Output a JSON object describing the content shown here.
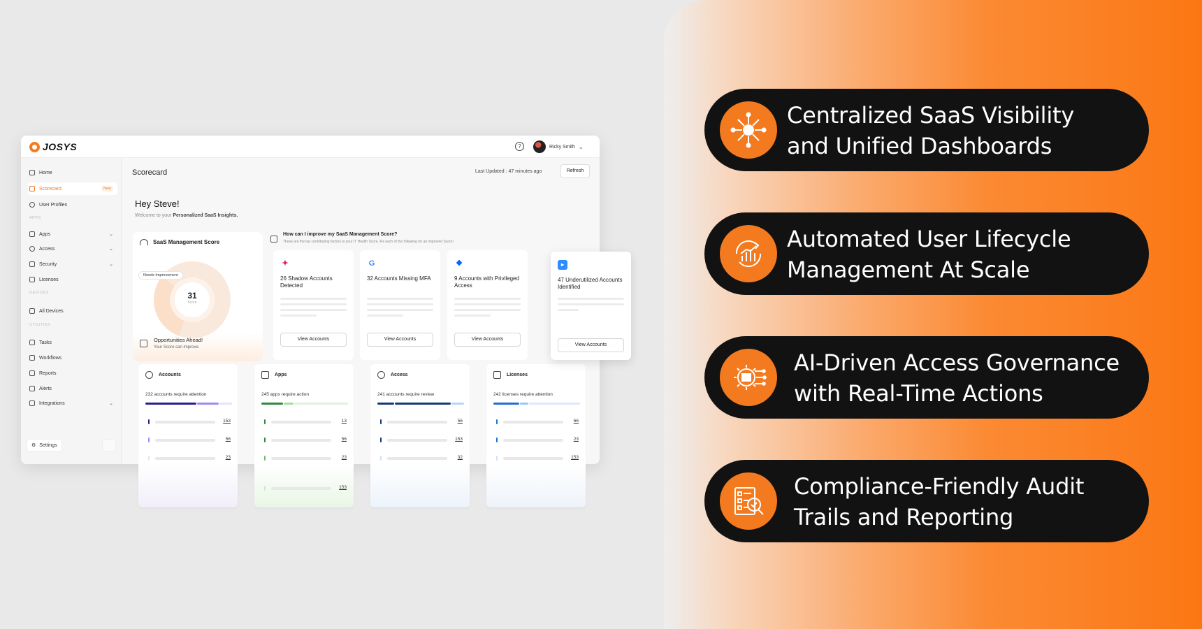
{
  "brand": {
    "logo_text": "JOSYS"
  },
  "topbar": {
    "help_icon": "question-circle-icon",
    "user_name": "Ricky Smith"
  },
  "sidebar": {
    "items": [
      {
        "label": "Home",
        "icon": "home-icon"
      },
      {
        "label": "Scorecard",
        "icon": "gauge-icon",
        "badge": "New",
        "active": true
      },
      {
        "label": "User Profiles",
        "icon": "user-icon"
      },
      {
        "label": "Apps",
        "icon": "grid-icon"
      },
      {
        "label": "Access",
        "icon": "key-icon"
      },
      {
        "label": "Security",
        "icon": "shield-icon"
      },
      {
        "label": "Licenses",
        "icon": "license-icon"
      },
      {
        "label": "All Devices",
        "icon": "monitor-icon"
      },
      {
        "label": "Tasks",
        "icon": "list-icon"
      },
      {
        "label": "Workflows",
        "icon": "workflow-icon"
      },
      {
        "label": "Reports",
        "icon": "report-icon"
      },
      {
        "label": "Alerts",
        "icon": "alert-icon"
      },
      {
        "label": "Integrations",
        "icon": "integration-icon"
      }
    ],
    "sections": [
      "APPS",
      "DEVICES",
      "UTILITIES"
    ],
    "settings_label": "Settings"
  },
  "main": {
    "title": "Scorecard",
    "last_updated": "Last Updated : 47 minutes ago",
    "refresh_label": "Refresh",
    "greeting": "Hey Steve!",
    "welcome_prefix": "Welcome to your ",
    "welcome_bold": "Personalized SaaS Insights.",
    "score": {
      "title": "SaaS Management Score",
      "badge": "Needs Improvement",
      "value": "31",
      "value_label": "Score",
      "opps_title": "Opportunities Ahead!",
      "opps_sub": "Your Score can improve."
    },
    "improve": {
      "question": "How can I improve my SaaS Management Score?",
      "subtitle": "These are the top contributing factors to your IT Health Score. Fix each of the following for an improved Score!"
    },
    "factors": [
      {
        "title": "26 Shadow Accounts Detected",
        "logo": "slack-logo-icon",
        "color": "#e01e5a",
        "button": "View Accounts"
      },
      {
        "title": "32 Accounts Missing MFA",
        "logo": "google-logo-icon",
        "color": "#4285f4",
        "button": "View Accounts"
      },
      {
        "title": "9 Accounts with Privileged Access",
        "logo": "dropbox-logo-icon",
        "color": "#0061fe",
        "button": "View Accounts"
      },
      {
        "title": "47 Underutilized Accounts Identified",
        "logo": "zoom-logo-icon",
        "color": "#2d8cff",
        "button": "View Accounts"
      }
    ],
    "stats": [
      {
        "title": "Accounts",
        "subtitle": "232 accounts require attention",
        "color": "#2a1f8f",
        "light": "#9b8ef0",
        "rows": [
          "153",
          "56",
          "23"
        ]
      },
      {
        "title": "Apps",
        "subtitle": "245 apps require action",
        "color": "#2e8b3a",
        "light": "#a8dca0",
        "rows": [
          "13",
          "56",
          "23",
          "153"
        ]
      },
      {
        "title": "Access",
        "subtitle": "241 accounts require review",
        "color": "#123a7a",
        "light": "#b9d4f2",
        "rows": [
          "56",
          "153",
          "32"
        ]
      },
      {
        "title": "Licenses",
        "subtitle": "242 licenses require attention",
        "color": "#1f6fd1",
        "light": "#9cc4f0",
        "rows": [
          "66",
          "23",
          "153"
        ]
      }
    ]
  },
  "features": [
    {
      "line1": "Centralized SaaS Visibility",
      "line2": "and Unified Dashboards",
      "icon": "network-hub-icon"
    },
    {
      "line1": "Automated User Lifecycle",
      "line2": "Management At Scale",
      "icon": "growth-cycle-icon"
    },
    {
      "line1": "AI-Driven Access Governance",
      "line2": "with Real-Time Actions",
      "icon": "ai-gear-icon"
    },
    {
      "line1": "Compliance-Friendly Audit",
      "line2": "Trails and Reporting",
      "icon": "audit-checklist-icon"
    }
  ],
  "colors": {
    "accent": "#f47a1f",
    "pill_bg": "#121212"
  }
}
